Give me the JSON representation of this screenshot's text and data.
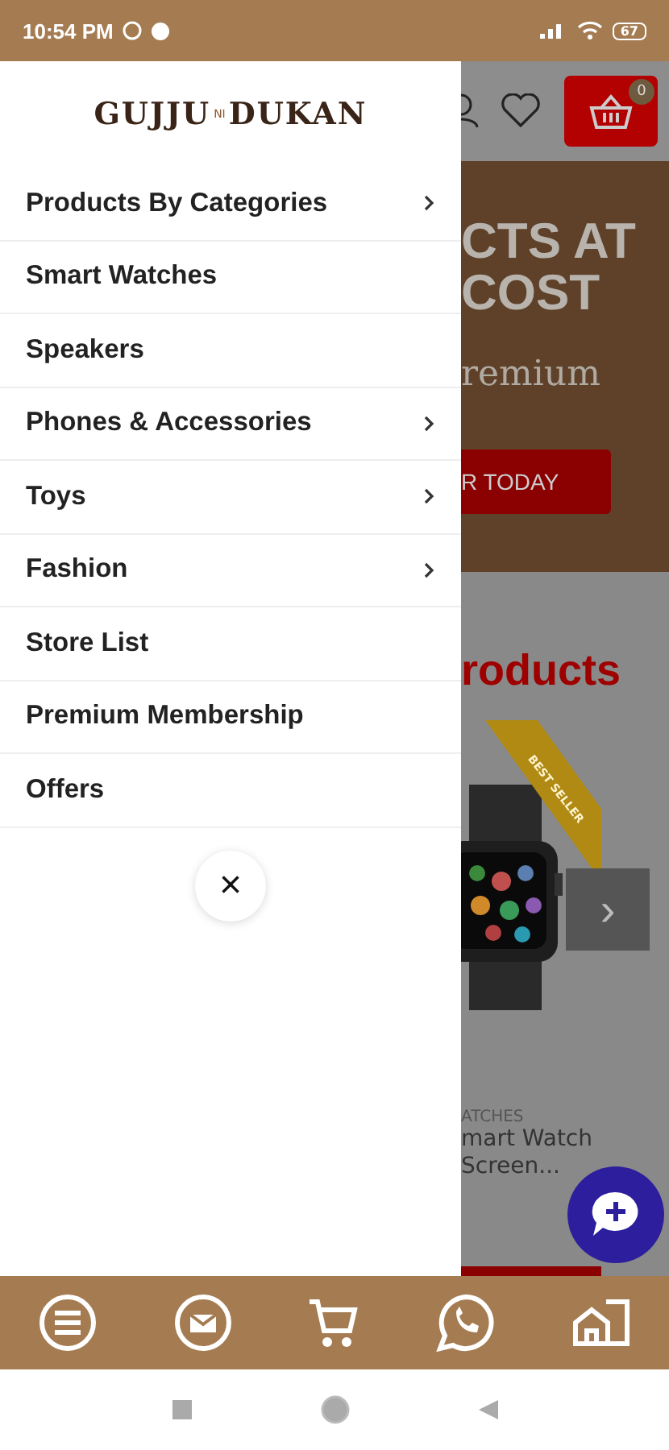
{
  "status_bar": {
    "time": "10:54 PM",
    "battery": "67"
  },
  "drawer": {
    "logo": [
      "GUJJU",
      "NI",
      "DUKAN"
    ],
    "items": [
      {
        "label": "Products By Categories",
        "has_submenu": true
      },
      {
        "label": "Smart Watches",
        "has_submenu": false
      },
      {
        "label": "Speakers",
        "has_submenu": false
      },
      {
        "label": "Phones & Accessories",
        "has_submenu": true
      },
      {
        "label": "Toys",
        "has_submenu": true
      },
      {
        "label": "Fashion",
        "has_submenu": true
      },
      {
        "label": "Store List",
        "has_submenu": false
      },
      {
        "label": "Premium Membership",
        "has_submenu": false
      },
      {
        "label": "Offers",
        "has_submenu": false
      }
    ],
    "close": "×"
  },
  "page": {
    "cart_count": "0",
    "banner": {
      "lines": [
        "CTS AT",
        "COST"
      ],
      "subtitle": "remium",
      "button": "R TODAY"
    },
    "section_title": "roducts",
    "product": {
      "ribbon": "BEST SELLER",
      "next": "›",
      "category": "ATCHES",
      "name_lines": [
        "mart Watch",
        "Screen..."
      ]
    }
  }
}
